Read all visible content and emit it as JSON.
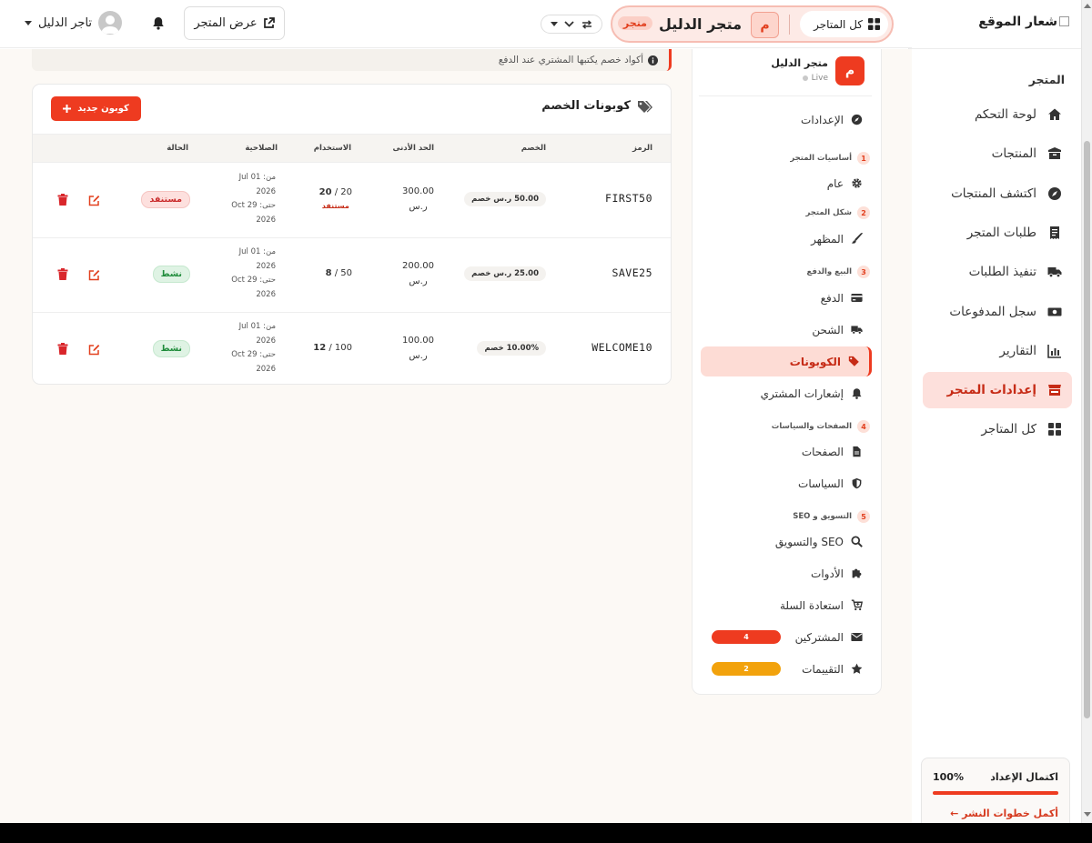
{
  "sidebar": {
    "logo_text": "شعار الموقع",
    "section_title": "المتجر",
    "items": [
      {
        "label": "لوحة التحكم",
        "icon": "home-icon"
      },
      {
        "label": "المنتجات",
        "icon": "box-icon"
      },
      {
        "label": "اكتشف المنتجات",
        "icon": "compass-icon"
      },
      {
        "label": "طلبات المتجر",
        "icon": "receipt-icon"
      },
      {
        "label": "تنفيذ الطلبات",
        "icon": "truck-icon"
      },
      {
        "label": "سجل المدفوعات",
        "icon": "money-icon"
      },
      {
        "label": "التقارير",
        "icon": "chart-icon"
      },
      {
        "label": "إعدادات المتجر",
        "icon": "store-icon",
        "active": true
      },
      {
        "label": "كل المتاجر",
        "icon": "grid-icon"
      }
    ],
    "progress": {
      "title": "اكتمال الإعداد",
      "value_text": "100%",
      "value": 1.0,
      "link": "أكمل خطوات النشر ←"
    }
  },
  "topbar": {
    "all_stores": "كل المتاجر",
    "store_avatar": "م",
    "store_name": "متجر الدليل",
    "store_badge": "متجر",
    "view_store": "عرض المتجر",
    "user_name": "تاجر الدليل"
  },
  "info_text": "أكواد خصم يكتبها المشتري عند الدفع",
  "settings_nav": {
    "store_avatar": "م",
    "store_name": "متجر الدليل",
    "store_status": "Live",
    "items": [
      {
        "type": "item",
        "label": "الإعدادات",
        "icon": "compass-icon"
      },
      {
        "type": "group",
        "num": "1",
        "label": "أساسيات المتجر"
      },
      {
        "type": "item",
        "label": "عام",
        "icon": "gear-icon"
      },
      {
        "type": "group",
        "num": "2",
        "label": "شكل المتجر"
      },
      {
        "type": "item",
        "label": "المظهر",
        "icon": "brush-icon"
      },
      {
        "type": "group",
        "num": "3",
        "label": "البيع والدفع"
      },
      {
        "type": "item",
        "label": "الدفع",
        "icon": "credit-card-icon"
      },
      {
        "type": "item",
        "label": "الشحن",
        "icon": "truck-icon"
      },
      {
        "type": "item",
        "label": "الكوبونات",
        "icon": "tags-icon",
        "active": true
      },
      {
        "type": "item",
        "label": "إشعارات المشتري",
        "icon": "bell-icon"
      },
      {
        "type": "group",
        "num": "4",
        "label": "الصفحات والسياسات"
      },
      {
        "type": "item",
        "label": "الصفحات",
        "icon": "file-icon"
      },
      {
        "type": "item",
        "label": "السياسات",
        "icon": "shield-icon"
      },
      {
        "type": "group",
        "num": "5",
        "label": "التسويق و SEO"
      },
      {
        "type": "item",
        "label": "SEO والتسويق",
        "icon": "search-icon"
      },
      {
        "type": "item",
        "label": "الأدوات",
        "icon": "puzzle-icon"
      },
      {
        "type": "item",
        "label": "استعادة السلة",
        "icon": "cart-icon"
      },
      {
        "type": "item",
        "label": "المشتركين",
        "icon": "envelope-icon",
        "badge": "4",
        "badge_color": "#ee3b20"
      },
      {
        "type": "item",
        "label": "التقييمات",
        "icon": "star-icon",
        "badge": "2",
        "badge_color": "#f2a20c"
      }
    ]
  },
  "coupons": {
    "title": "كوبونات الخصم",
    "new_button": "كوبون جديد",
    "columns": {
      "code": "الرمز",
      "discount": "الخصم",
      "min": "الحد الأدنى",
      "usage": "الاستخدام",
      "validity": "الصلاحية",
      "status": "الحالة"
    },
    "rows": [
      {
        "code": "FIRST50",
        "discount": "50.00 ر.س خصم",
        "min_amount": "300.00",
        "min_currency": "ر.س",
        "usage_used": "20",
        "usage_limit": "20",
        "usage_note": "مستنفد",
        "from_line": "من: 01 Jul",
        "from_year": "2026",
        "to_line": "حتى: 29 Oct",
        "to_year": "2026",
        "status": "مستنفد",
        "status_type": "used"
      },
      {
        "code": "SAVE25",
        "discount": "25.00 ر.س خصم",
        "min_amount": "200.00",
        "min_currency": "ر.س",
        "usage_used": "8",
        "usage_limit": "50",
        "usage_note": "",
        "from_line": "من: 01 Jul",
        "from_year": "2026",
        "to_line": "حتى: 29 Oct",
        "to_year": "2026",
        "status": "نشط",
        "status_type": "active"
      },
      {
        "code": "WELCOME10",
        "discount": "10.00% خصم",
        "min_amount": "100.00",
        "min_currency": "ر.س",
        "usage_used": "12",
        "usage_limit": "100",
        "usage_note": "",
        "from_line": "من: 01 Jul",
        "from_year": "2026",
        "to_line": "حتى: 29 Oct",
        "to_year": "2026",
        "status": "نشط",
        "status_type": "active"
      }
    ]
  },
  "colors": {
    "accent": "#ee3b20",
    "active_bg": "#fde0dc",
    "success": "#1f8c3b",
    "danger": "#c92b2b"
  }
}
